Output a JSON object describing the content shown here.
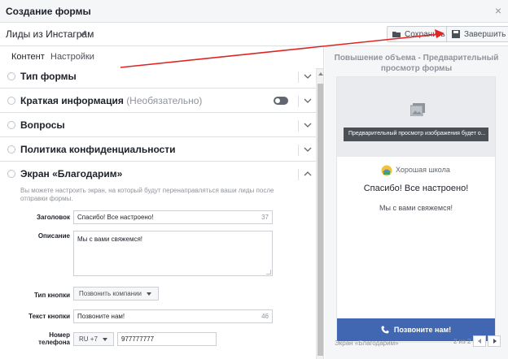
{
  "window": {
    "title": "Создание формы"
  },
  "form": {
    "name": "Лиды из Инстаграм"
  },
  "toolbar": {
    "save_label": "Сохранить",
    "finish_label": "Завершить"
  },
  "tabs": [
    {
      "label": "Контент",
      "active": true
    },
    {
      "label": "Настройки",
      "active": false
    }
  ],
  "sections": {
    "form_type": "Тип формы",
    "intro": "Краткая информация",
    "intro_optional": "(Необязательно)",
    "questions": "Вопросы",
    "privacy": "Политика конфиденциальности",
    "thanks": "Экран «Благодарим»"
  },
  "thanks_screen": {
    "description": "Вы можете настроить экран, на который будут перенаправляться ваши лиды после отправки формы.",
    "headline_label": "Заголовок",
    "headline_value": "Спасибо! Все настроено!",
    "headline_count": "37",
    "desc_label": "Описание",
    "desc_value": "Мы с вами свяжемся!",
    "button_type_label": "Тип кнопки",
    "button_type_value": "Позвонить компании",
    "button_text_label": "Текст кнопки",
    "button_text_value": "Позвоните нам!",
    "button_text_count": "46",
    "phone_label_1": "Номер",
    "phone_label_2": "телефона",
    "country_code": "RU +7",
    "phone_value": "977777777"
  },
  "preview": {
    "title": "Повышение объема - Предварительный просмотр формы",
    "image_tip": "Предварительный просмотр изображения будет о...",
    "brand": "Хорошая школа",
    "headline": "Спасибо! Все настроено!",
    "description": "Мы с вами свяжемся!",
    "cta": "Позвоните нам!",
    "screen_name": "Экран «Благодарим»",
    "pager": "2 из 2"
  },
  "colors": {
    "accent": "#4267b2",
    "annotation": "#e02424"
  }
}
